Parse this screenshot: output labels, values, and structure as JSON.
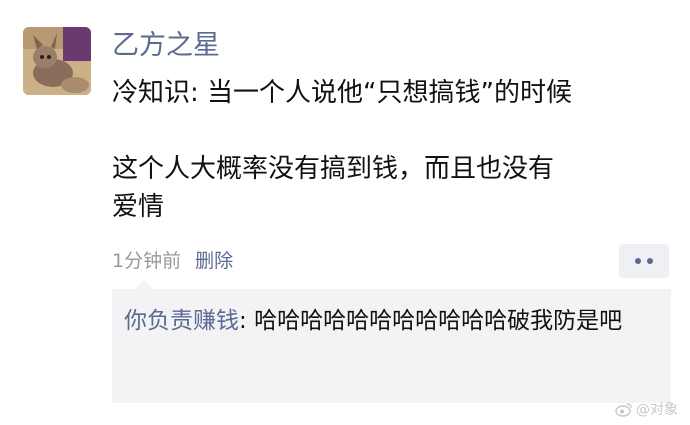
{
  "post": {
    "author": "乙方之星",
    "lines": [
      "冷知识: 当一个人说他“只想搞钱”的时候",
      "",
      "这个人大概率没有搞到钱，而且也没有",
      "爱情"
    ],
    "time": "1分钟前",
    "delete_label": "删除",
    "more_icon": "more-dots-icon"
  },
  "comment": {
    "author": "你负责赚钱",
    "separator": ":",
    "text": "哈哈哈哈哈哈哈哈哈哈哈破我防是吧"
  },
  "watermark": {
    "text": "@对象",
    "icon": "weibo-logo-icon"
  },
  "colors": {
    "link": "#5b6a92",
    "text": "#111111",
    "muted": "#9a9a9a",
    "comment_bg": "#f3f3f5"
  }
}
